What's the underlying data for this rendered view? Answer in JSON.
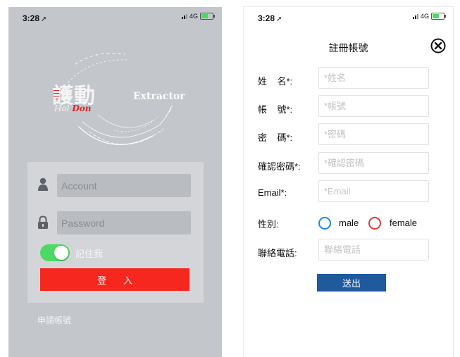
{
  "status_bar": {
    "time": "3:28",
    "network": "4G"
  },
  "login": {
    "logo": {
      "chinese": "護動",
      "english_hol": "Hol",
      "english_don": "Don",
      "product": "Extractor"
    },
    "account_placeholder": "Account",
    "password_placeholder": "Password",
    "remember_label": "記住我",
    "remember_on": true,
    "login_button": "登入",
    "register_link": "申請帳號"
  },
  "register": {
    "title": "註冊帳號",
    "fields": [
      {
        "label": "姓    名*:",
        "placeholder": "*姓名"
      },
      {
        "label": "帳    號*:",
        "placeholder": "*帳號"
      },
      {
        "label": "密    碼*:",
        "placeholder": "*密碼"
      },
      {
        "label": "確認密碼*:",
        "placeholder": "*確認密碼"
      },
      {
        "label": "Email*:",
        "placeholder": "*Email"
      }
    ],
    "gender_label": "性別:",
    "gender_options": [
      {
        "label": "male",
        "color": "#1e88e5"
      },
      {
        "label": "female",
        "color": "#e53935"
      }
    ],
    "phone_label": "聯絡電話:",
    "phone_placeholder": "聯絡電話",
    "submit_button": "送出"
  },
  "colors": {
    "accent_red": "#f5271e",
    "submit_blue": "#1f5a9c",
    "toggle_green": "#4cd964"
  }
}
